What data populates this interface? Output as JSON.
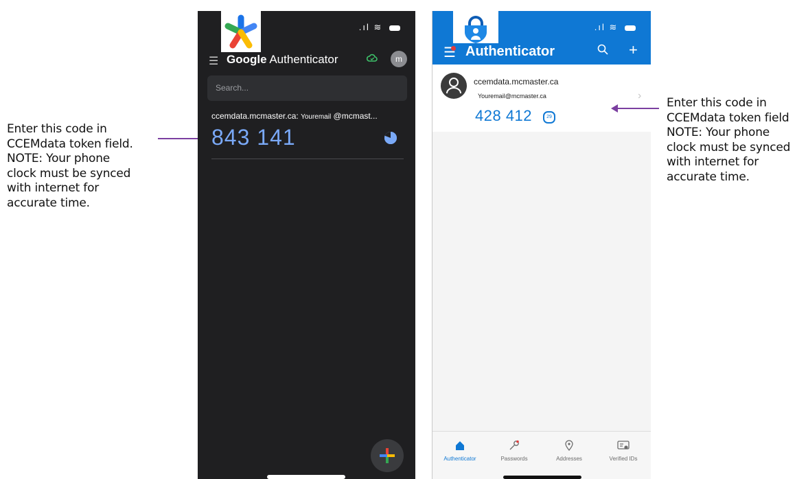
{
  "left_note": [
    "Enter this code in",
    "CCEMdata token field.",
    "NOTE: Your phone",
    "clock must be synced",
    "with internet for",
    "accurate time."
  ],
  "right_note": [
    "Enter this code in",
    "CCEMdata token field",
    "NOTE: Your phone",
    "clock must be synced",
    "with internet for",
    "accurate time."
  ],
  "google": {
    "title_bold": "Google",
    "title_rest": " Authenticator",
    "avatar_letter": "m",
    "search_placeholder": "Search...",
    "account_issuer": "ccemdata.mcmaster.ca:",
    "account_user_small": "Youremail",
    "account_user_rest": "@mcmast...",
    "code": "843 141"
  },
  "microsoft": {
    "title": "Authenticator",
    "account_name": "ccemdata.mcmaster.ca",
    "account_email": "Youremail@mcmaster.ca",
    "code": "428 412",
    "timer_value": "29",
    "tabs": [
      {
        "label": "Authenticator"
      },
      {
        "label": "Passwords"
      },
      {
        "label": "Addresses"
      },
      {
        "label": "Verified IDs"
      }
    ]
  },
  "colors": {
    "arrow": "#7b3fa0",
    "google_bg": "#1f1f21",
    "google_code": "#7aa9f7",
    "ms_header": "#0f78d4"
  }
}
